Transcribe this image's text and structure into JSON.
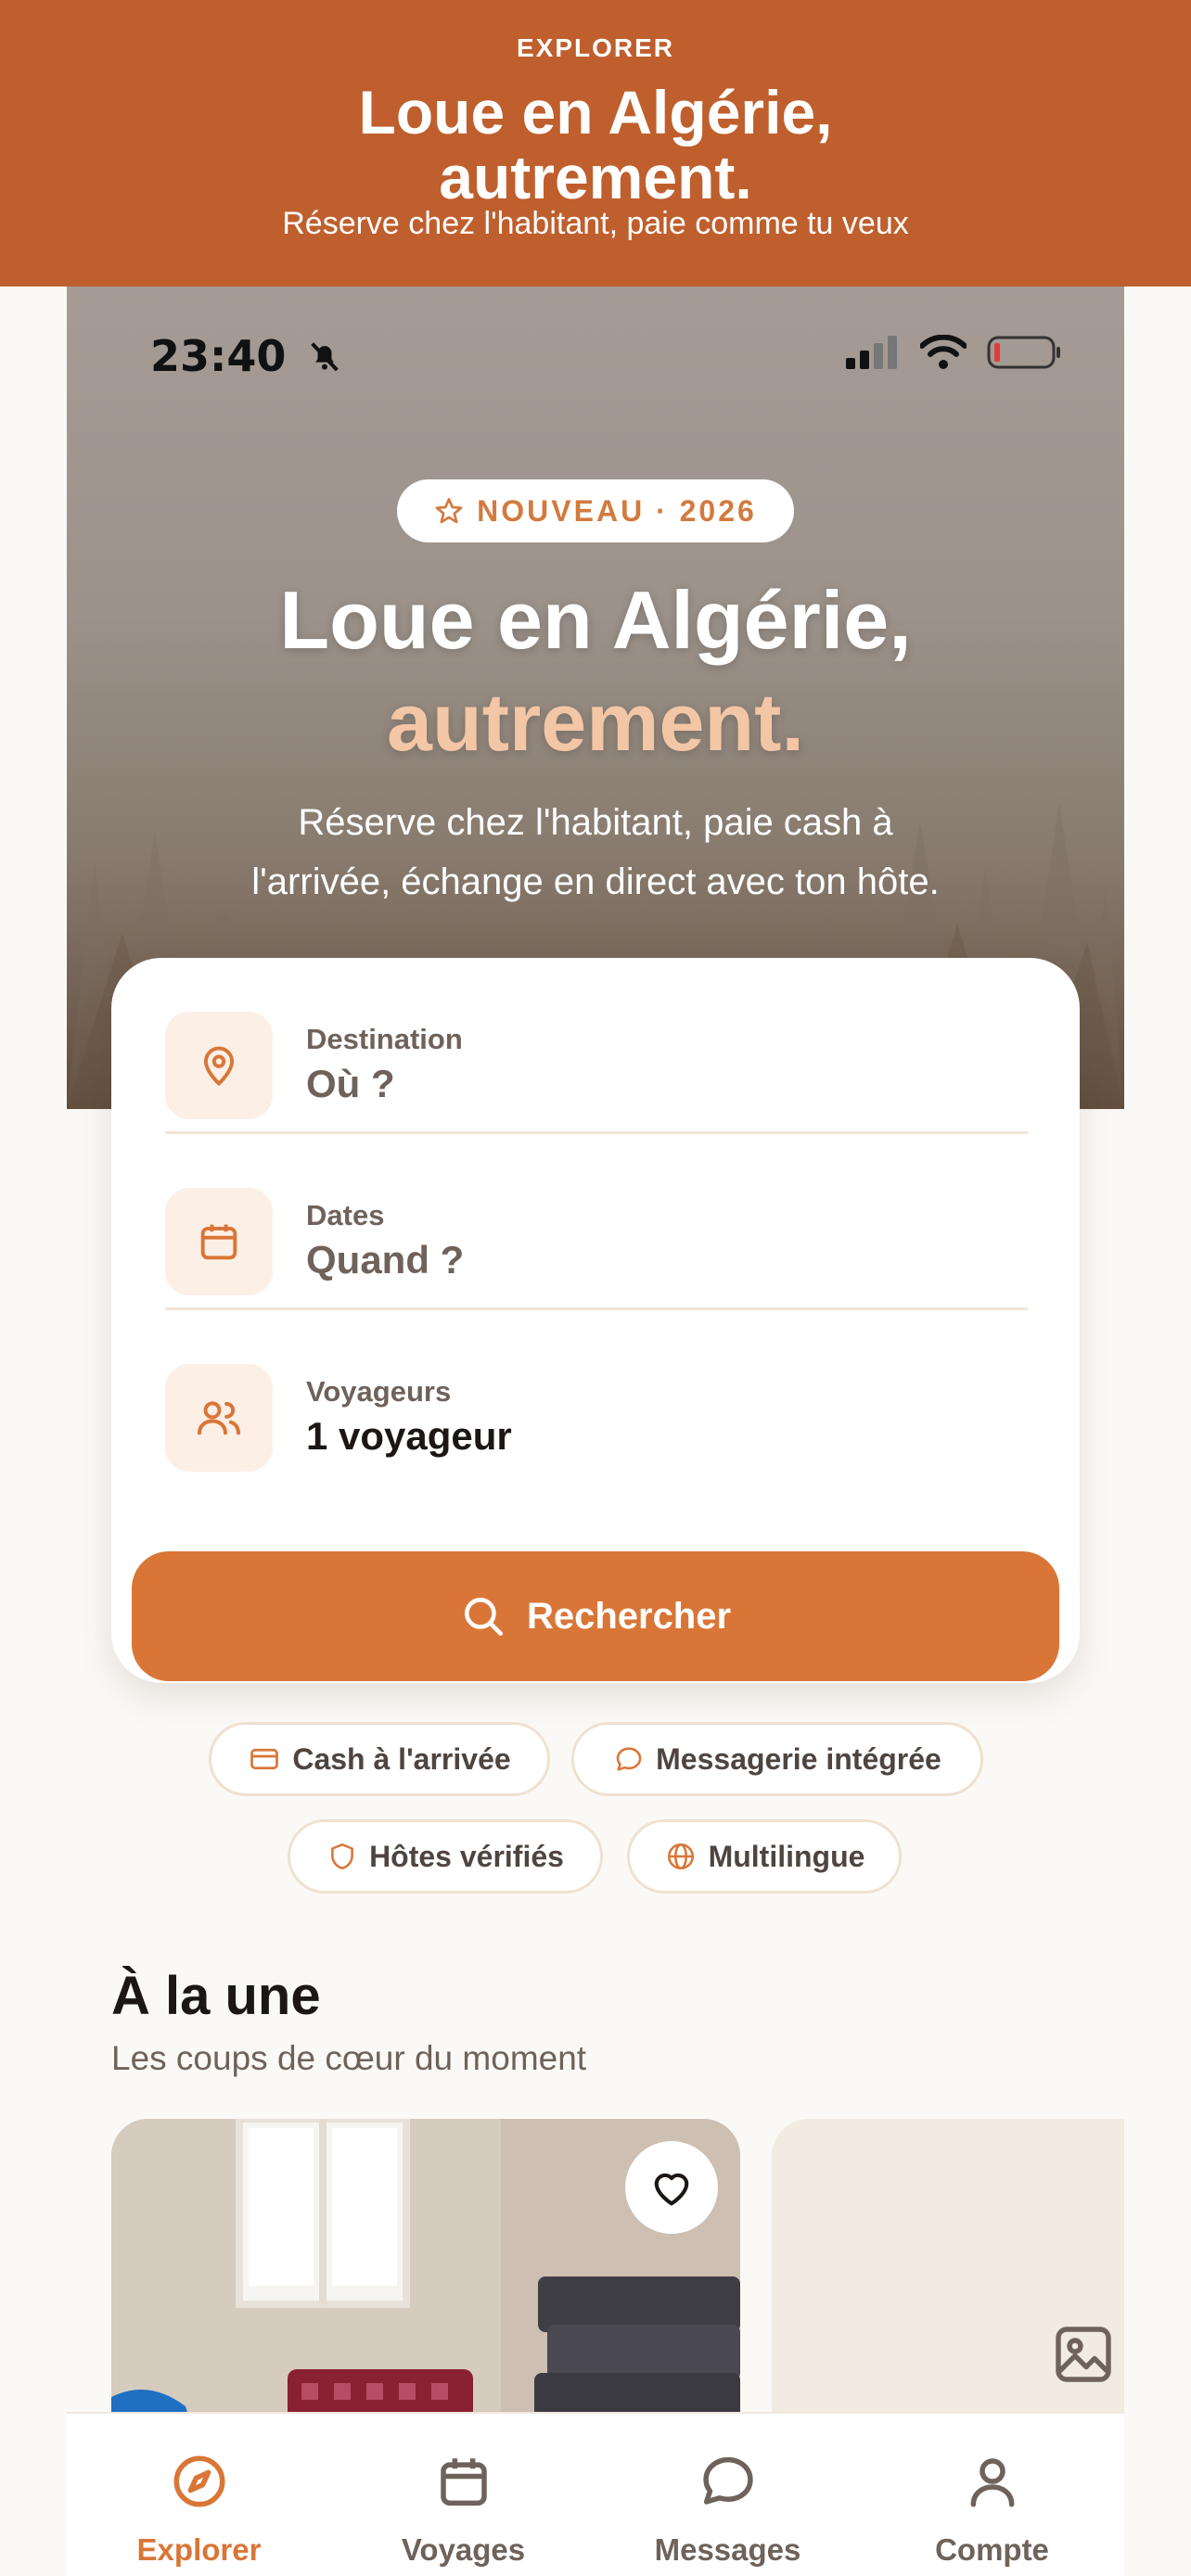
{
  "banner": {
    "kicker": "EXPLORER",
    "title_line1": "Loue en Algérie,",
    "title_line2": "autrement.",
    "subtitle": "Réserve chez l'habitant, paie comme tu veux"
  },
  "status_bar": {
    "time": "23:40"
  },
  "hero": {
    "badge": "NOUVEAU · 2026",
    "title_line1": "Loue en Algérie,",
    "title_accent": "autrement.",
    "subtitle_line1": "Réserve chez l'habitant, paie cash à",
    "subtitle_line2": "l'arrivée, échange en direct avec ton hôte."
  },
  "search": {
    "destination": {
      "label": "Destination",
      "value": "Où ?"
    },
    "dates": {
      "label": "Dates",
      "value": "Quand ?"
    },
    "travelers": {
      "label": "Voyageurs",
      "value": "1 voyageur"
    },
    "button": "Rechercher"
  },
  "features": [
    {
      "label": "Cash à l'arrivée",
      "icon": "card-icon"
    },
    {
      "label": "Messagerie intégrée",
      "icon": "chat-icon"
    },
    {
      "label": "Hôtes vérifiés",
      "icon": "shield-icon"
    },
    {
      "label": "Multilingue",
      "icon": "globe-icon"
    }
  ],
  "featured": {
    "title": "À la une",
    "subtitle": "Les coups de cœur du moment"
  },
  "tabs": [
    {
      "label": "Explorer",
      "icon": "compass-icon",
      "active": true
    },
    {
      "label": "Voyages",
      "icon": "calendar-icon",
      "active": false
    },
    {
      "label": "Messages",
      "icon": "chat-icon",
      "active": false
    },
    {
      "label": "Compte",
      "icon": "user-icon",
      "active": false
    }
  ],
  "colors": {
    "brand": "#d97637",
    "banner": "#bf5f2d",
    "accent_text": "#f3c6a6"
  }
}
